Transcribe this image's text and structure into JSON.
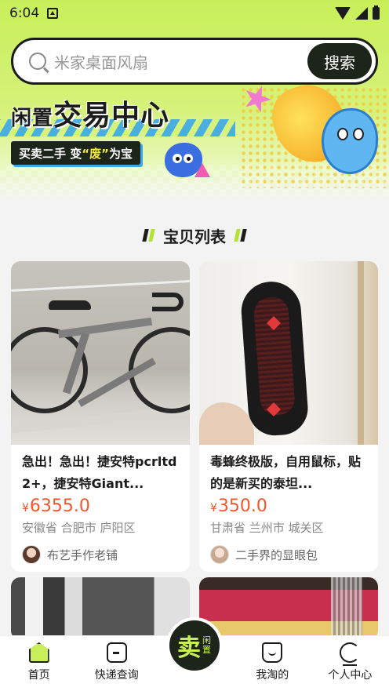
{
  "status_bar": {
    "time": "6:04"
  },
  "search": {
    "placeholder": "米家桌面风扇",
    "button_label": "搜索"
  },
  "banner": {
    "title_small": "闲置",
    "title_large": "交易中心",
    "subtitle_pre": "买卖二手  变",
    "subtitle_highlight": "“废”",
    "subtitle_post": "为宝"
  },
  "section": {
    "title": "宝贝列表"
  },
  "products": [
    {
      "title": "急出！急出！捷安特pcrltd2+，捷安特Giant...",
      "currency": "¥",
      "price": "6355.0",
      "location": "安徽省 合肥市 庐阳区",
      "seller": "布艺手作老铺"
    },
    {
      "title": "毒蜂终极版，自用鼠标，贴的是新买的泰坦...",
      "currency": "¥",
      "price": "350.0",
      "location": "甘肃省 兰州市 城关区",
      "seller": "二手界的显眼包"
    }
  ],
  "tabbar": {
    "home": "首页",
    "express": "快递查询",
    "sell_big": "卖",
    "sell_small": "闲置",
    "mine_taobao": "我淘的",
    "profile": "个人中心"
  },
  "colors": {
    "accent": "#c8ef5a",
    "dark": "#1d2419",
    "price": "#f0572d"
  }
}
